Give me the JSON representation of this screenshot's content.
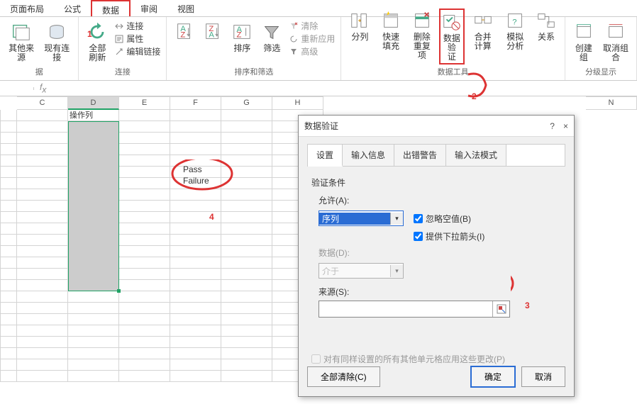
{
  "tabs": {
    "layout": "页面布局",
    "formula": "公式",
    "data": "数据",
    "review": "审阅",
    "view": "视图"
  },
  "ribbon": {
    "other": "其他来源",
    "conn": "现有连接",
    "refresh": "全部刷新",
    "connList": "连接",
    "prop": "属性",
    "edit": "编辑链接",
    "connGrp": "连接",
    "sort": "排序",
    "filter": "筛选",
    "clear": "清除",
    "reapply": "重新应用",
    "advanced": "高级",
    "sfGrp": "排序和筛选",
    "split": "分列",
    "flash": "快速填充",
    "dedup": "删除\n重复项",
    "valid": "数据验\n证",
    "consol": "合并计算",
    "whatif": "模拟分析",
    "rel": "关系",
    "dtGrp": "数据工具",
    "group": "创建组",
    "ungroup": "取消组合",
    "sub": "分级显示",
    "secLabel": "据"
  },
  "sheet": {
    "cols": [
      "C",
      "D",
      "E",
      "F",
      "G",
      "H",
      "N"
    ],
    "headerCell": "操作列",
    "pass": "Pass",
    "fail": "Failure"
  },
  "dlg": {
    "title": "数据验证",
    "help": "?",
    "close": "×",
    "tabs": {
      "settings": "设置",
      "input": "输入信息",
      "error": "出错警告",
      "ime": "输入法模式"
    },
    "cond": "验证条件",
    "allow": "允许(A):",
    "allowVal": "序列",
    "ignore": "忽略空值(B)",
    "dropdown": "提供下拉箭头(I)",
    "dataLbl": "数据(D):",
    "dataVal": "介于",
    "source": "来源(S):",
    "apply": "对有同样设置的所有其他单元格应用这些更改(P)",
    "clear": "全部清除(C)",
    "ok": "确定",
    "cancel": "取消"
  },
  "annot": {
    "one": "1",
    "two": "2",
    "three": "3",
    "four": "4"
  }
}
